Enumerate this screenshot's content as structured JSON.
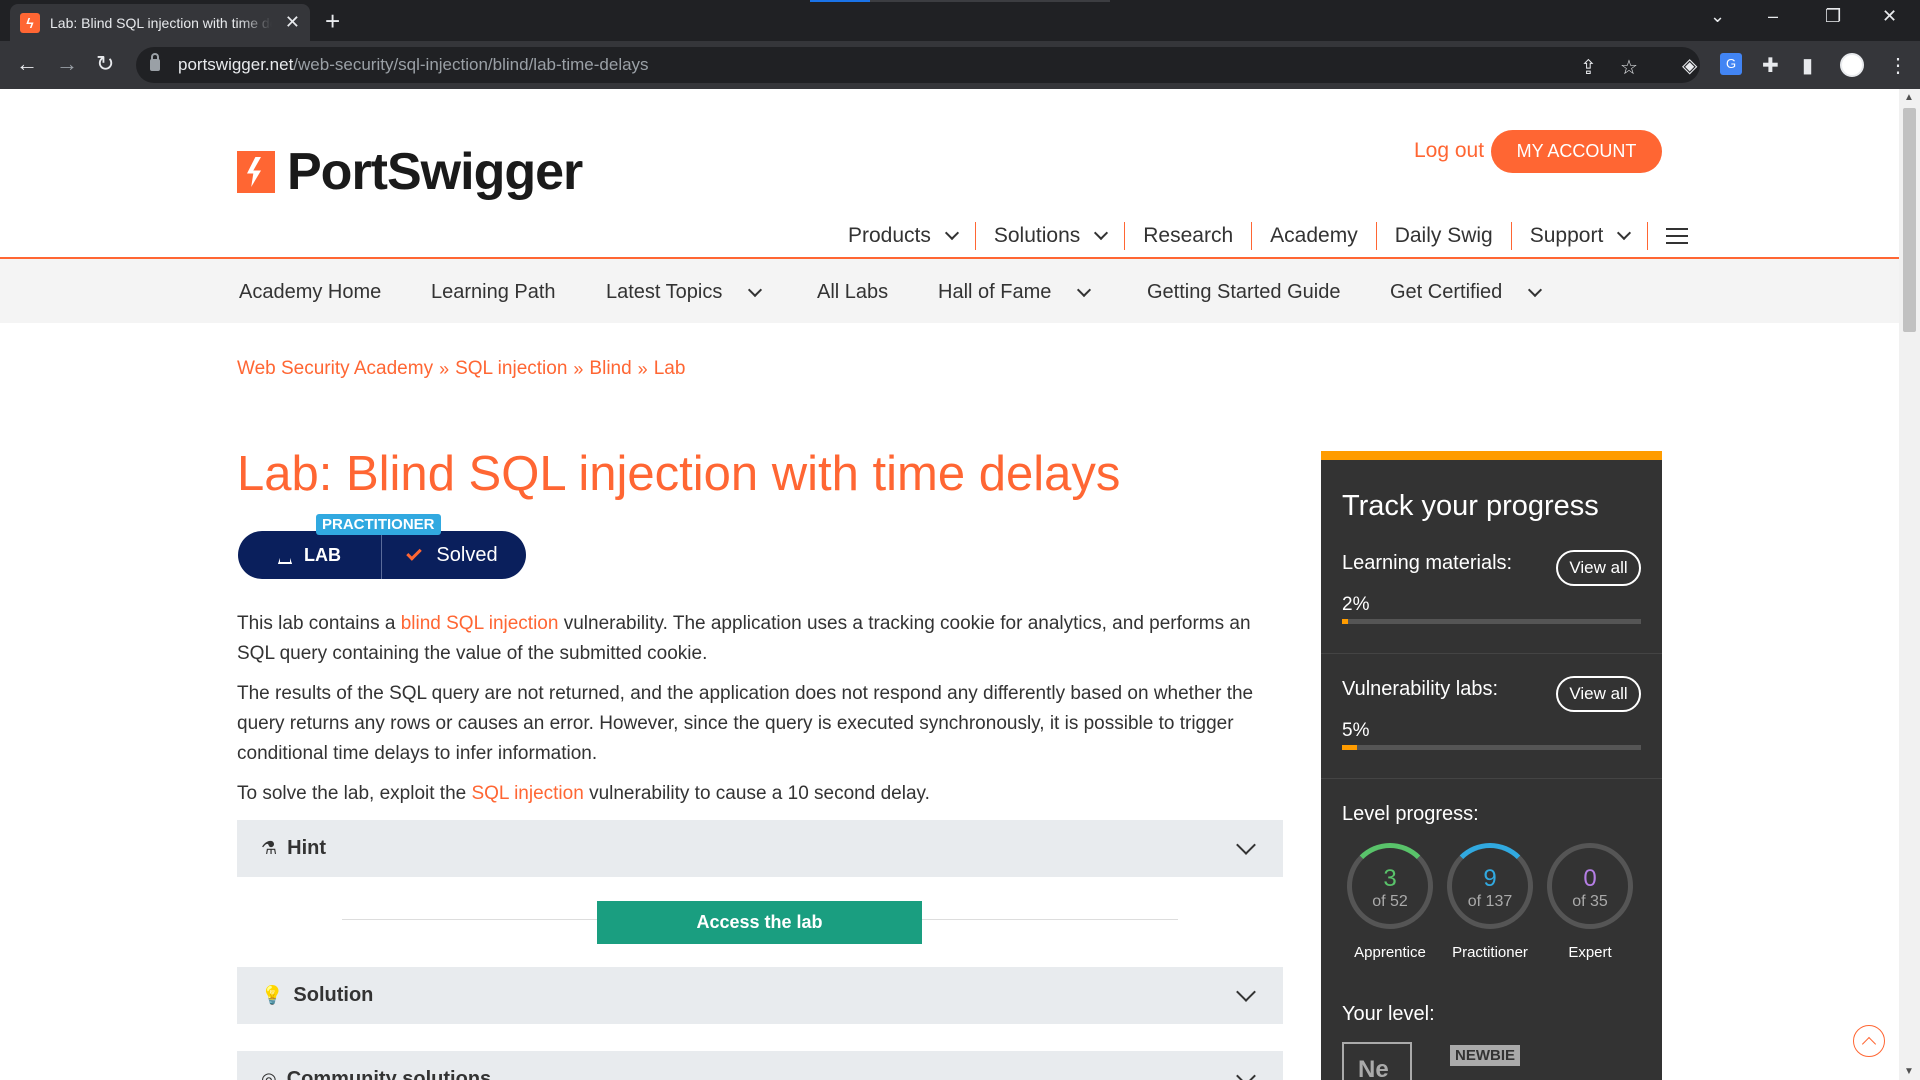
{
  "browser": {
    "tab_title": "Lab: Blind SQL injection with time delays",
    "url_host": "portswigger.net",
    "url_path": "/web-security/sql-injection/blind/lab-time-delays"
  },
  "header": {
    "logo_text": "PortSwigger",
    "logout": "Log out",
    "my_account": "MY ACCOUNT"
  },
  "main_nav": [
    {
      "label": "Products",
      "dropdown": true
    },
    {
      "label": "Solutions",
      "dropdown": true
    },
    {
      "label": "Research",
      "dropdown": false
    },
    {
      "label": "Academy",
      "dropdown": false
    },
    {
      "label": "Daily Swig",
      "dropdown": false
    },
    {
      "label": "Support",
      "dropdown": true
    }
  ],
  "sub_nav": [
    {
      "label": "Academy Home",
      "dropdown": false
    },
    {
      "label": "Learning Path",
      "dropdown": false
    },
    {
      "label": "Latest Topics",
      "dropdown": true
    },
    {
      "label": "All Labs",
      "dropdown": false
    },
    {
      "label": "Hall of Fame",
      "dropdown": true
    },
    {
      "label": "Getting Started Guide",
      "dropdown": false
    },
    {
      "label": "Get Certified",
      "dropdown": true
    }
  ],
  "breadcrumb": [
    "Web Security Academy",
    "SQL injection",
    "Blind",
    "Lab"
  ],
  "breadcrumb_sep": "»",
  "page": {
    "title": "Lab: Blind SQL injection with time delays",
    "level_tag": "PRACTITIONER",
    "lab_label": "LAB",
    "status": "Solved",
    "p1_before": "This lab contains a ",
    "p1_link": "blind SQL injection",
    "p1_after": " vulnerability. The application uses a tracking cookie for analytics, and performs an SQL query containing the value of the submitted cookie.",
    "p2": "The results of the SQL query are not returned, and the application does not respond any differently based on whether the query returns any rows or causes an error. However, since the query is executed synchronously, it is possible to trigger conditional time delays to infer information.",
    "p3_before": "To solve the lab, exploit the ",
    "p3_link": "SQL injection",
    "p3_after": " vulnerability to cause a 10 second delay.",
    "hint_label": "Hint",
    "access_lab": "Access the lab",
    "solution_label": "Solution",
    "community_label": "Community solutions"
  },
  "progress": {
    "title": "Track your progress",
    "learning_label": "Learning materials:",
    "learning_pct": "2%",
    "learning_value": 0.02,
    "vuln_label": "Vulnerability labs:",
    "vuln_pct": "5%",
    "vuln_value": 0.05,
    "view_all": "View all",
    "level_label": "Level progress:",
    "levels": [
      {
        "num": "3",
        "of": "of 52",
        "name": "Apprentice",
        "color": "#59c36a"
      },
      {
        "num": "9",
        "of": "of 137",
        "name": "Practitioner",
        "color": "#31a9e0"
      },
      {
        "num": "0",
        "of": "of 35",
        "name": "Expert",
        "color": "#b57ee5"
      }
    ],
    "your_level": "Your level:",
    "level_box": "Ne",
    "level_tag": "NEWBIE"
  },
  "colors": {
    "brand": "#ff6633",
    "lab_badge": "#0a1f5c",
    "access_button": "#1a9e80",
    "progress_accent": "#ff9c00"
  }
}
